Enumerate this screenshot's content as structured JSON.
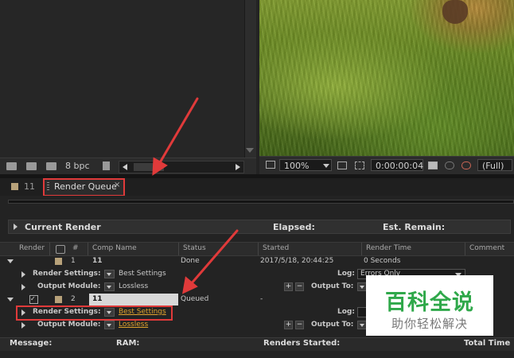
{
  "project": {
    "bpc_label": "8 bpc"
  },
  "viewer": {
    "zoom": "100%",
    "timecode": "0:00:00:04",
    "resolution": "(Full)"
  },
  "tabs": [
    {
      "label": "11"
    },
    {
      "label": "Render Queue",
      "close": "×"
    }
  ],
  "current_render": {
    "label": "Current Render",
    "elapsed_label": "Elapsed:",
    "remain_label": "Est. Remain:"
  },
  "columns": [
    "Render",
    "#",
    "Comp Name",
    "Status",
    "Started",
    "Render Time",
    "Comment"
  ],
  "items": [
    {
      "num": "1",
      "comp": "11",
      "status": "Done",
      "started": "2017/5/18, 20:44:25",
      "render_time": "0 Seconds",
      "render_settings_label": "Render Settings:",
      "render_settings_value": "Best Settings",
      "output_module_label": "Output Module:",
      "output_module_value": "Lossless",
      "log_label": "Log:",
      "log_value": "Errors Only",
      "output_to_label": "Output To:"
    },
    {
      "num": "2",
      "comp": "11",
      "status": "Queued",
      "started": "-",
      "render_settings_label": "Render Settings:",
      "render_settings_value": "Best Settings",
      "output_module_label": "Output Module:",
      "output_module_value": "Lossless",
      "log_label": "Log:",
      "output_to_label": "Output To:"
    }
  ],
  "statusbar": {
    "message": "Message:",
    "ram": "RAM:",
    "renders_started": "Renders Started:",
    "total_time": "Total Time"
  },
  "watermark": {
    "title": "百科全说",
    "subtitle": "助你轻松解决"
  },
  "colors": {
    "accent_orange": "#e0a32d",
    "annotation_red": "#e03a3a",
    "watermark_green": "#2fa84a"
  }
}
